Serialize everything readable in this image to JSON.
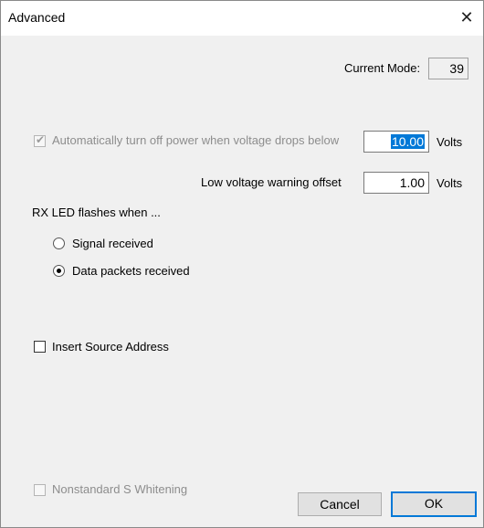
{
  "window": {
    "title": "Advanced",
    "close_glyph": "✕"
  },
  "current_mode": {
    "label": "Current Mode:",
    "value": "39"
  },
  "auto_power_off": {
    "label": "Automatically turn off power when voltage drops below",
    "value": "10.00",
    "unit": "Volts",
    "checked": true,
    "enabled": false
  },
  "low_voltage": {
    "label": "Low voltage warning offset",
    "value": "1.00",
    "unit": "Volts"
  },
  "rx_led": {
    "heading": "RX LED flashes when ...",
    "options": [
      {
        "label": "Signal received",
        "selected": false
      },
      {
        "label": "Data packets received",
        "selected": true
      }
    ]
  },
  "insert_source": {
    "label": "Insert Source Address",
    "checked": false
  },
  "nonstandard": {
    "label": "Nonstandard S Whitening",
    "checked": false,
    "enabled": false
  },
  "buttons": {
    "cancel": "Cancel",
    "ok": "OK"
  }
}
